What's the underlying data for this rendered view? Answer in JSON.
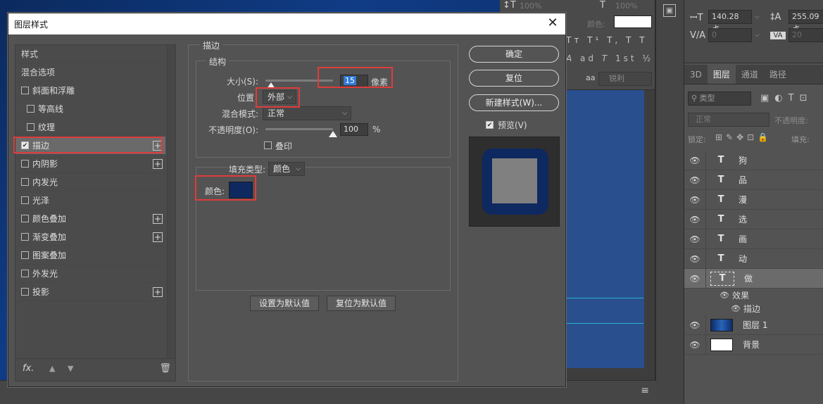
{
  "colors": {
    "stroke_color": "#0e2860",
    "highlight_red": "#e03b3b",
    "selection_blue": "#2f7ad6"
  },
  "workspace": {
    "toolbar_icons": [
      "character-panel-icon"
    ],
    "options_fragment": {
      "percent_a": "100%",
      "percent_b": "100%",
      "color_label": "颜色:",
      "sharpness_value": "锐利",
      "aa_label": "aa"
    },
    "character": {
      "font_size": "140.28 点",
      "leading": "255.09 点",
      "kerning": "0",
      "tracking": "20"
    }
  },
  "layers_panel": {
    "tabs": [
      {
        "label": "3D",
        "active": false
      },
      {
        "label": "图层",
        "active": true
      },
      {
        "label": "通道",
        "active": false
      },
      {
        "label": "路径",
        "active": false
      }
    ],
    "filter_label": "类型",
    "blend_mode": "正常",
    "opacity_label": "不透明度:",
    "lock_label": "锁定:",
    "fill_label": "填充:",
    "layers": [
      {
        "type": "text",
        "name": "狗"
      },
      {
        "type": "text",
        "name": "品"
      },
      {
        "type": "text",
        "name": "漫"
      },
      {
        "type": "text",
        "name": "选"
      },
      {
        "type": "text",
        "name": "画"
      },
      {
        "type": "text",
        "name": "动"
      },
      {
        "type": "text",
        "name": "做",
        "selected": true
      }
    ],
    "effects_label": "效果",
    "effect_stroke_label": "描边",
    "image_layers": [
      {
        "name": "图层 1",
        "thumb": "photo"
      },
      {
        "name": "背景",
        "thumb": "white"
      }
    ]
  },
  "dialog": {
    "title": "图层样式",
    "styles_header": "样式",
    "blend_options": "混合选项",
    "style_items": [
      {
        "label": "斜面和浮雕",
        "checked": false,
        "indent": false,
        "plus": false
      },
      {
        "label": "等高线",
        "checked": false,
        "indent": true,
        "plus": false
      },
      {
        "label": "纹理",
        "checked": false,
        "indent": true,
        "plus": false
      },
      {
        "label": "描边",
        "checked": true,
        "indent": false,
        "plus": true,
        "selected": true
      },
      {
        "label": "内阴影",
        "checked": false,
        "indent": false,
        "plus": true
      },
      {
        "label": "内发光",
        "checked": false,
        "indent": false,
        "plus": false
      },
      {
        "label": "光泽",
        "checked": false,
        "indent": false,
        "plus": false
      },
      {
        "label": "颜色叠加",
        "checked": false,
        "indent": false,
        "plus": true
      },
      {
        "label": "渐变叠加",
        "checked": false,
        "indent": false,
        "plus": true
      },
      {
        "label": "图案叠加",
        "checked": false,
        "indent": false,
        "plus": false
      },
      {
        "label": "外发光",
        "checked": false,
        "indent": false,
        "plus": false
      },
      {
        "label": "投影",
        "checked": false,
        "indent": false,
        "plus": true
      }
    ],
    "footer_fx": "fx.",
    "stroke": {
      "group_title": "描边",
      "structure_title": "结构",
      "size_label": "大小(S):",
      "size_value": "15",
      "size_unit": "像素",
      "size_slider_fraction": 0.08,
      "position_label": "位置",
      "position_value": "外部",
      "blend_label": "混合模式:",
      "blend_value": "正常",
      "opacity_label": "不透明度(O):",
      "opacity_value": "100",
      "opacity_unit": "%",
      "opacity_slider_fraction": 1.0,
      "overprint_label": "叠印",
      "fill_type_label": "填充类型:",
      "fill_type_value": "颜色",
      "color_label": "颜色:",
      "set_default": "设置为默认值",
      "reset_default": "复位为默认值"
    },
    "buttons": {
      "ok": "确定",
      "reset": "复位",
      "new_style": "新建样式(W)...",
      "preview": "预览(V)"
    }
  }
}
